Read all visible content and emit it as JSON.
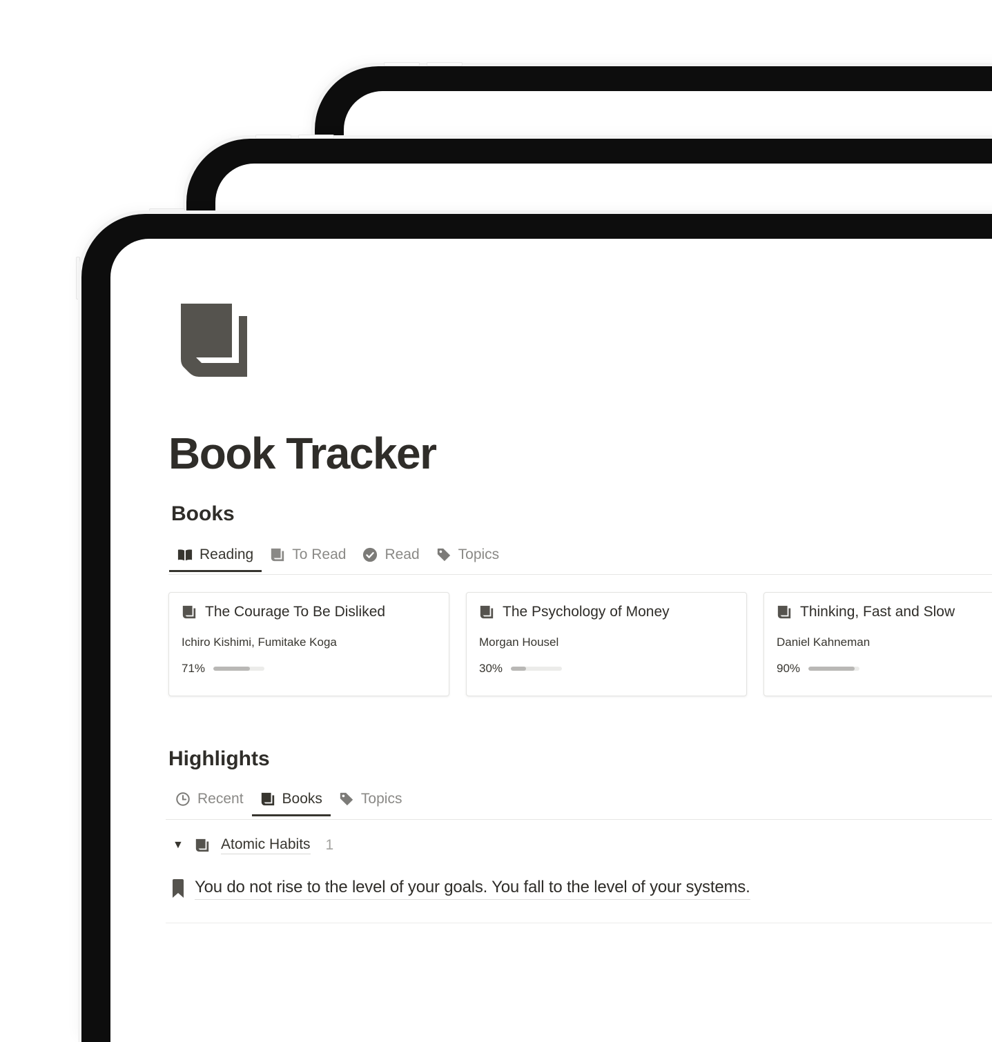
{
  "page": {
    "title": "Book Tracker",
    "icon": "book-stack-icon"
  },
  "books_section": {
    "title": "Books",
    "tabs": [
      {
        "label": "Reading",
        "icon": "open-book-icon",
        "active": true
      },
      {
        "label": "To Read",
        "icon": "book-stack-icon",
        "active": false
      },
      {
        "label": "Read",
        "icon": "check-circle-icon",
        "active": false
      },
      {
        "label": "Topics",
        "icon": "tag-icon",
        "active": false
      }
    ],
    "cards": [
      {
        "title": "The Courage To Be Disliked",
        "author": "Ichiro Kishimi, Fumitake Koga",
        "progress_label": "71%",
        "progress": 0.71
      },
      {
        "title": "The Psychology of Money",
        "author": "Morgan Housel",
        "progress_label": "30%",
        "progress": 0.3
      },
      {
        "title": "Thinking, Fast and Slow",
        "author": "Daniel Kahneman",
        "progress_label": "90%",
        "progress": 0.9
      }
    ]
  },
  "highlights_section": {
    "title": "Highlights",
    "tabs": [
      {
        "label": "Recent",
        "icon": "clock-icon",
        "active": false
      },
      {
        "label": "Books",
        "icon": "book-stack-icon",
        "active": true
      },
      {
        "label": "Topics",
        "icon": "tag-icon",
        "active": false
      }
    ],
    "groups": [
      {
        "name": "Atomic Habits",
        "count": "1",
        "expanded": true,
        "highlights": [
          {
            "text": "You do not rise to the level of your goals. You fall to the level of your systems.",
            "icon": "bookmark-icon"
          }
        ]
      }
    ]
  },
  "colors": {
    "text": "#37352f",
    "muted": "#8a8986",
    "icon": "#55534e",
    "bezel": "#0d0d0d",
    "progress_fill": "#b9b8b6",
    "progress_track": "#ececea"
  }
}
